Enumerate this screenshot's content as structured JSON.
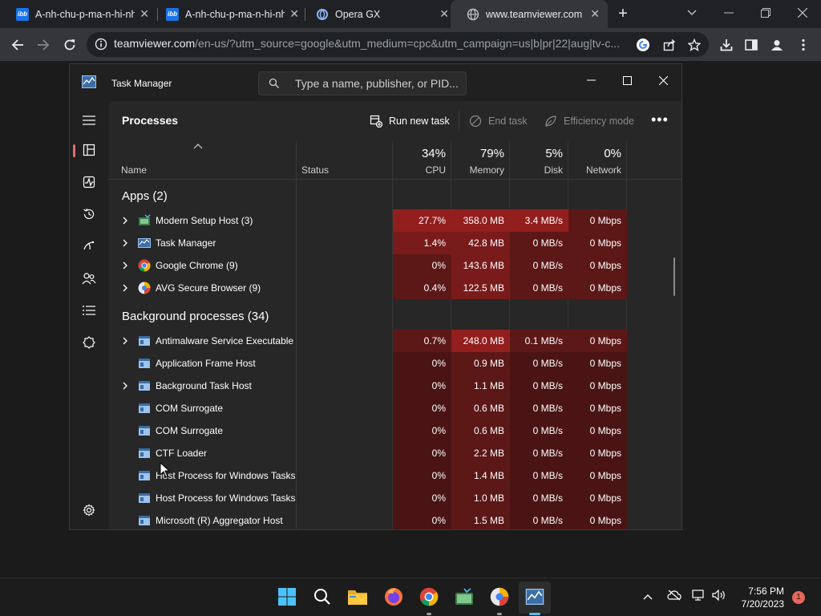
{
  "browser": {
    "tabs": [
      {
        "title": "A-nh-chu-p-ma-n-hi-nh",
        "favicon": "ibb-icon",
        "active": false
      },
      {
        "title": "A-nh-chu-p-ma-n-hi-nh",
        "favicon": "ibb-icon",
        "active": false
      },
      {
        "title": "Opera GX",
        "favicon": "opera-gx-icon",
        "active": false
      },
      {
        "title": "www.teamviewer.com",
        "favicon": "globe-icon",
        "active": true
      }
    ],
    "favicon_text": "ibb",
    "new_tab_glyph": "+",
    "close_glyph": "✕",
    "url_host": "teamviewer.com",
    "url_path": "/en-us/?utm_source=google&utm_medium=cpc&utm_campaign=us|b|pr|22|aug|tv-c..."
  },
  "task_manager": {
    "title": "Task Manager",
    "search_placeholder": "Type a name, publisher, or PID...",
    "page_title": "Processes",
    "commands": {
      "run_new_task": "Run new task",
      "end_task": "End task",
      "efficiency_mode": "Efficiency mode",
      "more": "•••"
    },
    "columns": {
      "name": "Name",
      "status": "Status",
      "cpu": {
        "pct": "34%",
        "label": "CPU"
      },
      "memory": {
        "pct": "79%",
        "label": "Memory"
      },
      "disk": {
        "pct": "5%",
        "label": "Disk"
      },
      "network": {
        "pct": "0%",
        "label": "Network"
      }
    },
    "sections": {
      "apps": "Apps (2)",
      "background": "Background processes (34)"
    },
    "apps": [
      {
        "name": "Modern Setup Host (3)",
        "icon": "setup-host-icon",
        "expandable": true,
        "cpu": "27.7%",
        "memory": "358.0 MB",
        "disk": "3.4 MB/s",
        "network": "0 Mbps"
      },
      {
        "name": "Task Manager",
        "icon": "task-manager-icon",
        "expandable": true,
        "cpu": "1.4%",
        "memory": "42.8 MB",
        "disk": "0 MB/s",
        "network": "0 Mbps"
      },
      {
        "name": "Google Chrome (9)",
        "icon": "chrome-icon",
        "expandable": true,
        "cpu": "0%",
        "memory": "143.6 MB",
        "disk": "0 MB/s",
        "network": "0 Mbps"
      },
      {
        "name": "AVG Secure Browser (9)",
        "icon": "avg-browser-icon",
        "expandable": true,
        "cpu": "0.4%",
        "memory": "122.5 MB",
        "disk": "0 MB/s",
        "network": "0 Mbps"
      }
    ],
    "background": [
      {
        "name": "Antimalware Service Executable",
        "icon": "process-icon",
        "expandable": true,
        "cpu": "0.7%",
        "memory": "248.0 MB",
        "disk": "0.1 MB/s",
        "network": "0 Mbps"
      },
      {
        "name": "Application Frame Host",
        "icon": "process-icon",
        "expandable": false,
        "cpu": "0%",
        "memory": "0.9 MB",
        "disk": "0 MB/s",
        "network": "0 Mbps"
      },
      {
        "name": "Background Task Host",
        "icon": "process-icon",
        "expandable": true,
        "cpu": "0%",
        "memory": "1.1 MB",
        "disk": "0 MB/s",
        "network": "0 Mbps"
      },
      {
        "name": "COM Surrogate",
        "icon": "process-icon",
        "expandable": false,
        "cpu": "0%",
        "memory": "0.6 MB",
        "disk": "0 MB/s",
        "network": "0 Mbps"
      },
      {
        "name": "COM Surrogate",
        "icon": "process-icon",
        "expandable": false,
        "cpu": "0%",
        "memory": "0.6 MB",
        "disk": "0 MB/s",
        "network": "0 Mbps"
      },
      {
        "name": "CTF Loader",
        "icon": "process-icon",
        "expandable": false,
        "cpu": "0%",
        "memory": "2.2 MB",
        "disk": "0 MB/s",
        "network": "0 Mbps"
      },
      {
        "name": "Host Process for Windows Tasks",
        "icon": "process-icon",
        "expandable": false,
        "cpu": "0%",
        "memory": "1.4 MB",
        "disk": "0 MB/s",
        "network": "0 Mbps"
      },
      {
        "name": "Host Process for Windows Tasks",
        "icon": "process-icon",
        "expandable": false,
        "cpu": "0%",
        "memory": "1.0 MB",
        "disk": "0 MB/s",
        "network": "0 Mbps"
      },
      {
        "name": "Microsoft (R) Aggregator Host",
        "icon": "process-icon",
        "expandable": false,
        "cpu": "0%",
        "memory": "1.5 MB",
        "disk": "0 MB/s",
        "network": "0 Mbps"
      }
    ]
  },
  "taskbar": {
    "time": "7:56 PM",
    "date": "7/20/2023",
    "notifications": "1",
    "pinned": [
      "windows-start-icon",
      "search-icon",
      "file-explorer-icon",
      "firefox-icon",
      "chrome-icon",
      "photos-icon",
      "avg-browser-icon",
      "task-manager-icon"
    ]
  },
  "colors": {
    "heat_low": "#4a1414",
    "heat_mid": "#5c1717",
    "heat_high": "#7a1b1b",
    "heat_max": "#931e1e",
    "nav_accent": "#e36b6b"
  }
}
